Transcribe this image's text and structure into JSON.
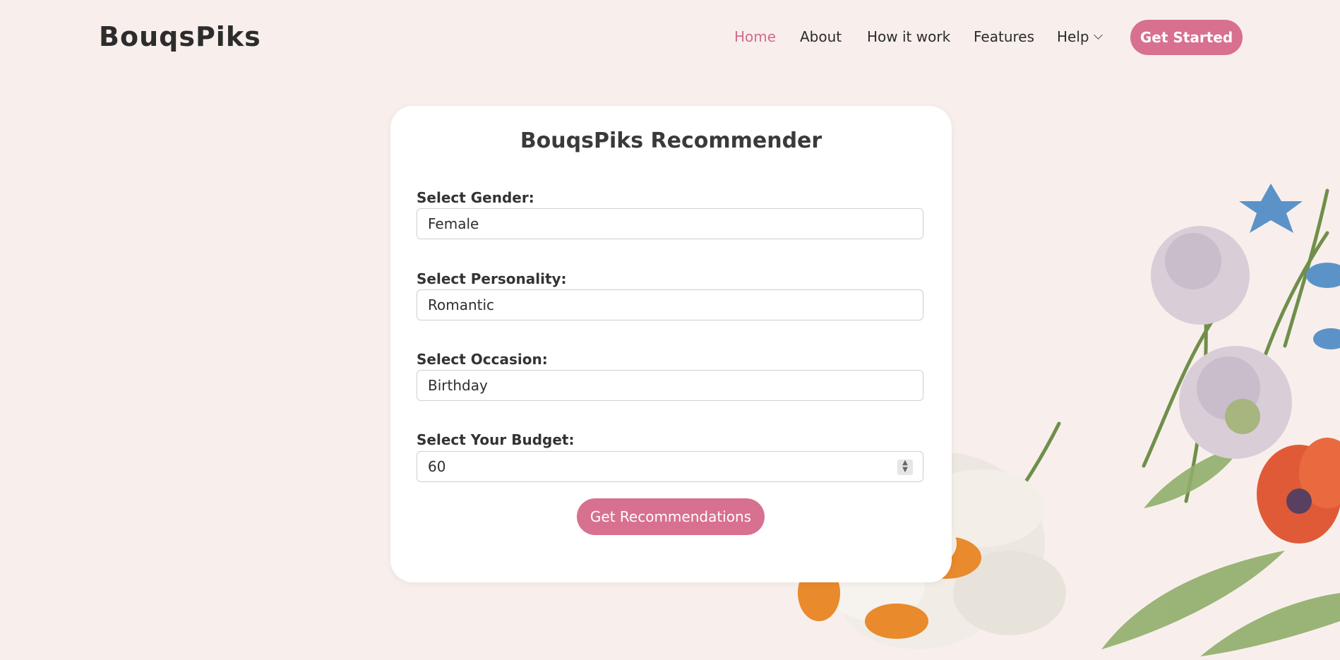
{
  "brand": {
    "logo": "BouqsPiks"
  },
  "nav": {
    "items": [
      {
        "label": "Home",
        "active": true
      },
      {
        "label": "About"
      },
      {
        "label": "How it work"
      },
      {
        "label": "Features"
      },
      {
        "label": "Help"
      }
    ],
    "cta_label": "Get Started"
  },
  "form": {
    "title": "BouqsPiks Recommender",
    "gender": {
      "label": "Select Gender:",
      "value": "Female"
    },
    "personality": {
      "label": "Select Personality:",
      "value": "Romantic"
    },
    "occasion": {
      "label": "Select Occasion:",
      "value": "Birthday"
    },
    "budget": {
      "label": "Select Your Budget:",
      "value": "60"
    },
    "submit_label": "Get Recommendations"
  },
  "colors": {
    "background": "#f8efec",
    "accent": "#d8708f",
    "card": "#ffffff"
  }
}
